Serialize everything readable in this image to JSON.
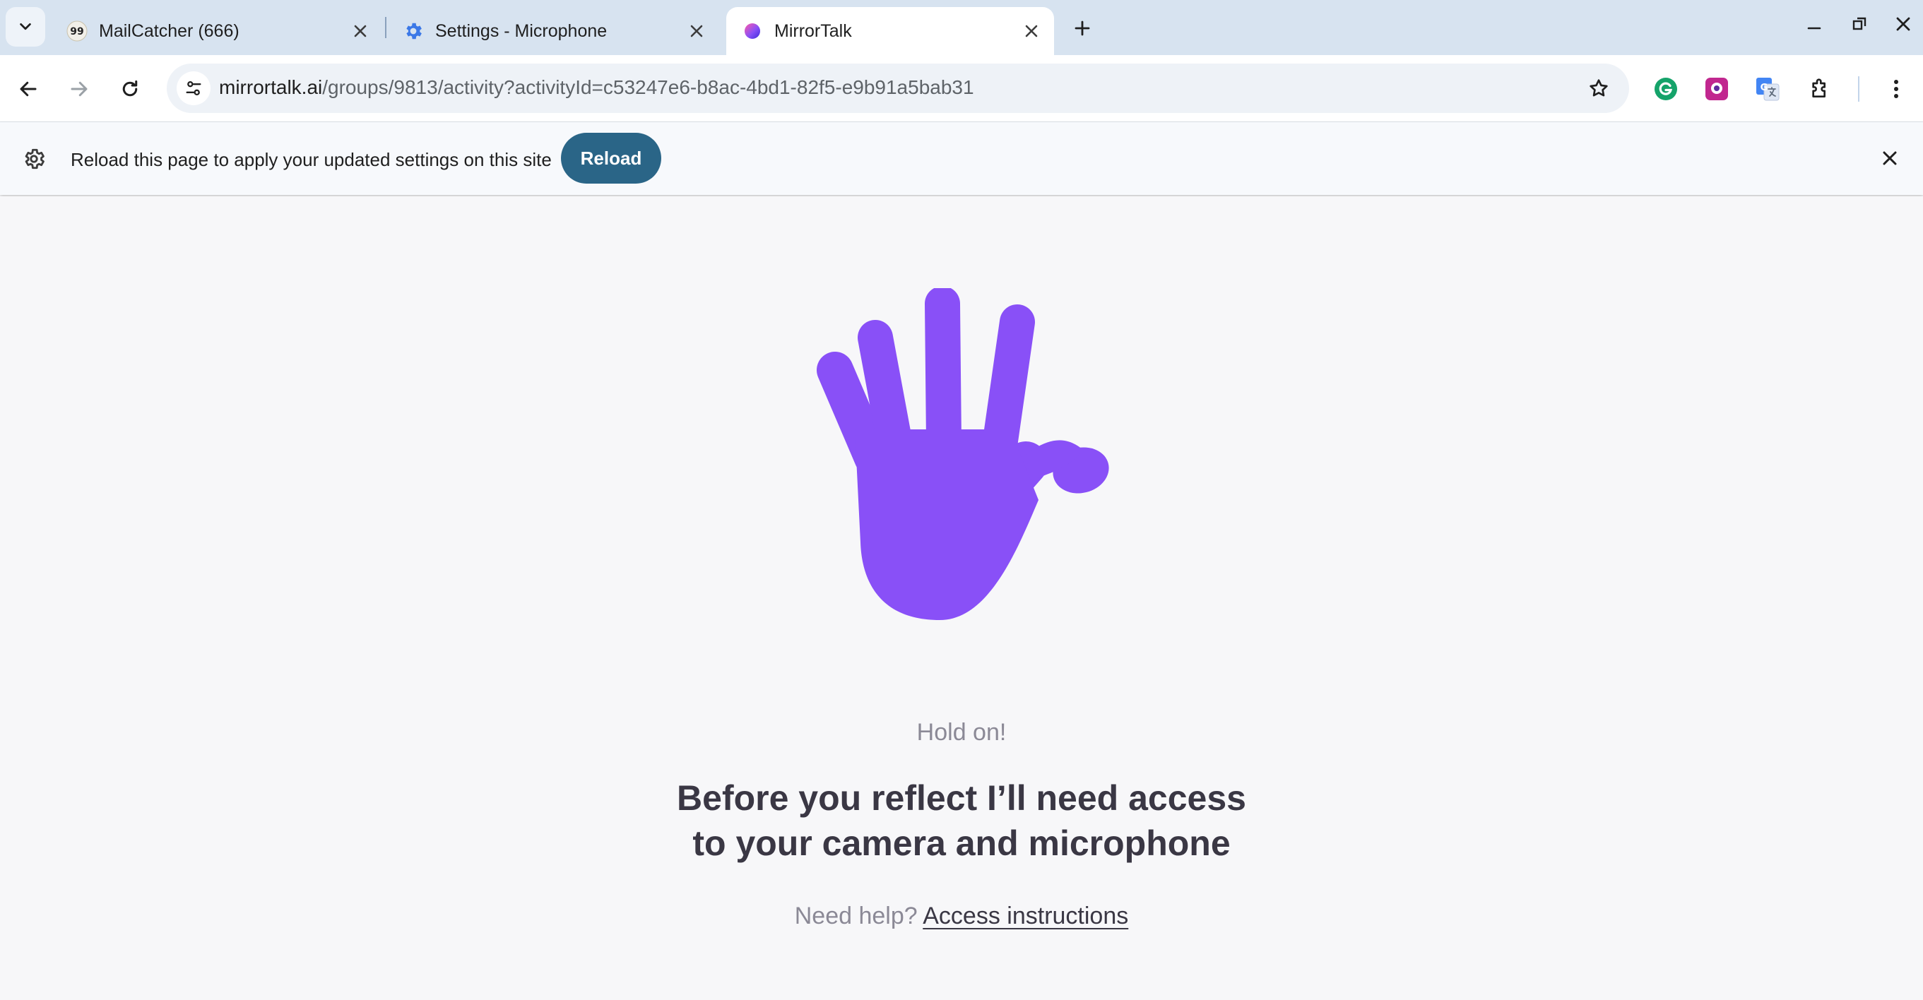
{
  "tabs": [
    {
      "title": "MailCatcher (666)",
      "favicon": "mailcatcher-favicon",
      "favicon_text": "99",
      "active": false
    },
    {
      "title": "Settings - Microphone",
      "favicon": "gear-icon",
      "active": false
    },
    {
      "title": "MirrorTalk",
      "favicon": "mirrortalk-favicon",
      "active": true
    }
  ],
  "omnibox": {
    "host": "mirrortalk.ai",
    "path": "/groups/9813/activity?activityId=c53247e6-b8ac-4bd1-82f5-e9b91a5bab31"
  },
  "infobar": {
    "message": "Reload this page to apply your updated settings on this site",
    "button_label": "Reload"
  },
  "page": {
    "hold_on": "Hold on!",
    "headline_line1": "Before you reflect I’ll need access",
    "headline_line2": "to your camera and microphone",
    "help_prefix": "Need help?",
    "help_link": "Access instructions"
  },
  "colors": {
    "hand": "#8950f7",
    "reload_button": "#2a6587",
    "tabstrip": "#d7e3f0"
  }
}
